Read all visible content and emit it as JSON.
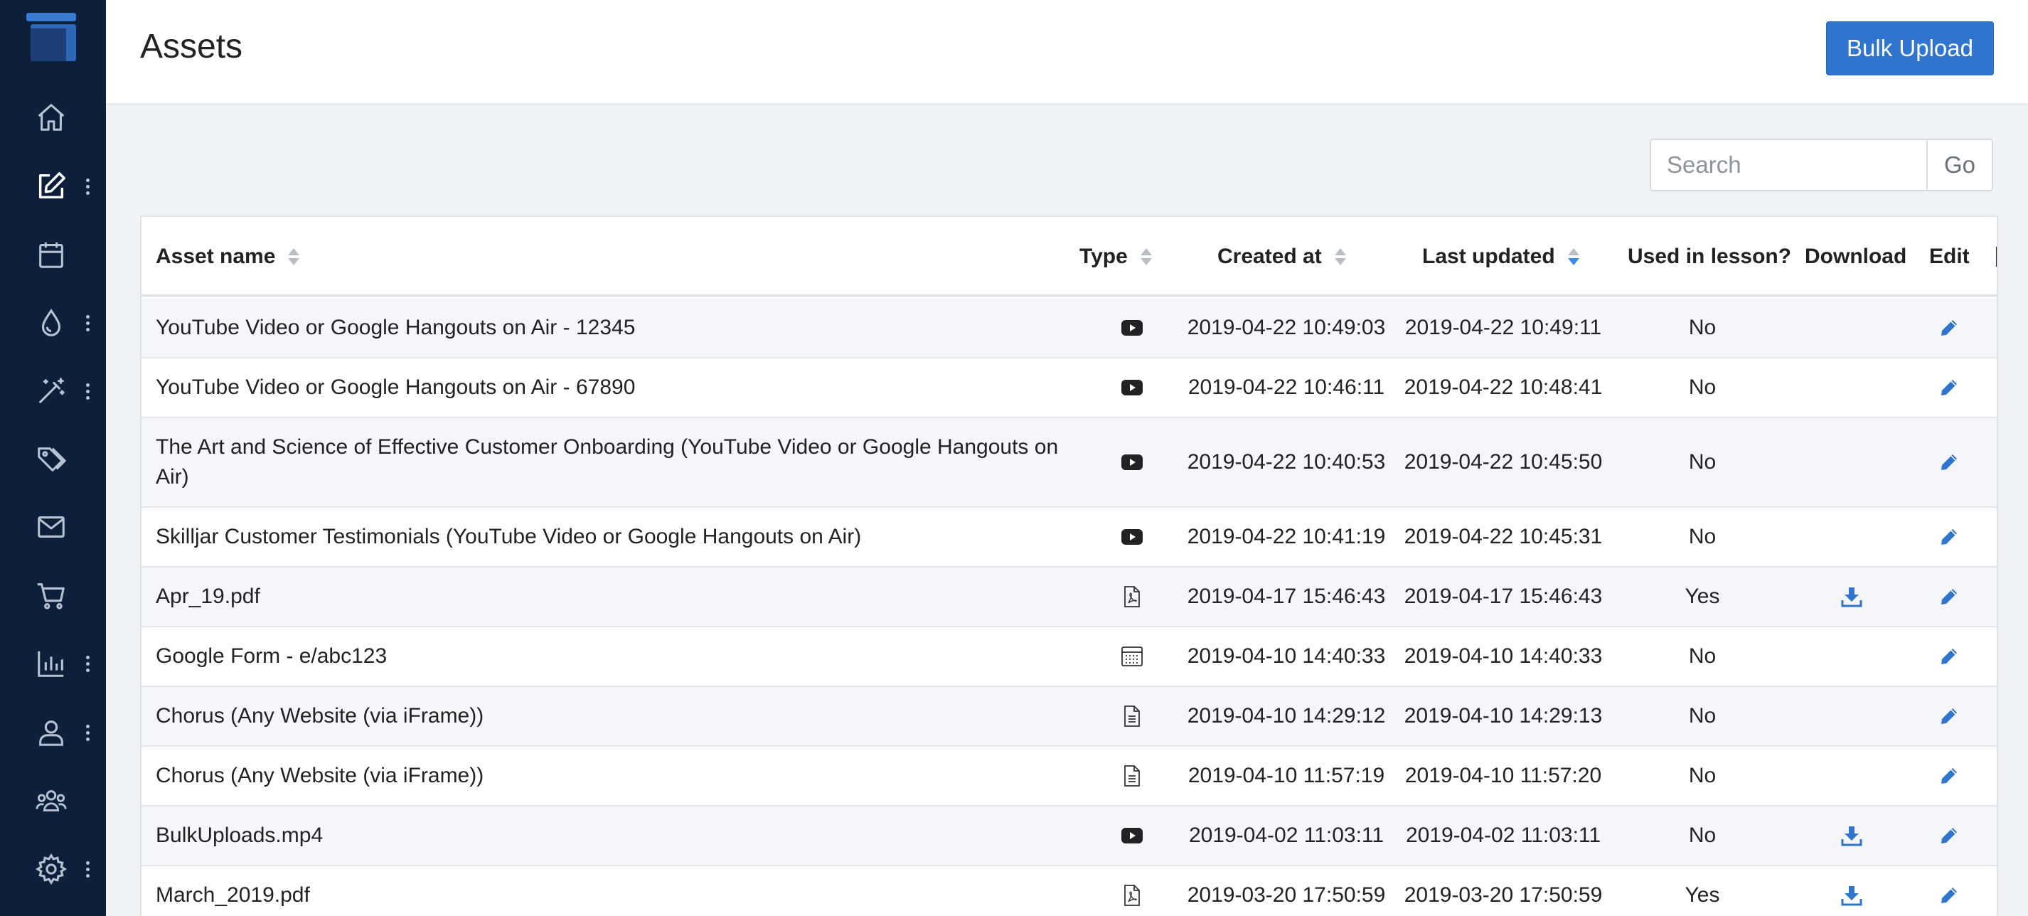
{
  "header": {
    "title": "Assets",
    "bulk_upload_label": "Bulk Upload"
  },
  "search": {
    "placeholder": "Search",
    "go_label": "Go"
  },
  "sidebar": {
    "items": [
      {
        "name": "home",
        "icon": "home-icon",
        "has_menu": false
      },
      {
        "name": "content",
        "icon": "edit-icon",
        "has_menu": true
      },
      {
        "name": "calendar",
        "icon": "calendar-icon",
        "has_menu": false
      },
      {
        "name": "theme",
        "icon": "drop-icon",
        "has_menu": true
      },
      {
        "name": "magic",
        "icon": "magic-wand-icon",
        "has_menu": true
      },
      {
        "name": "tags",
        "icon": "tags-icon",
        "has_menu": false
      },
      {
        "name": "mail",
        "icon": "mail-icon",
        "has_menu": false
      },
      {
        "name": "cart",
        "icon": "cart-icon",
        "has_menu": false
      },
      {
        "name": "analytics",
        "icon": "bar-chart-icon",
        "has_menu": true
      },
      {
        "name": "user",
        "icon": "user-icon",
        "has_menu": true
      },
      {
        "name": "groups",
        "icon": "users-icon",
        "has_menu": false
      },
      {
        "name": "settings",
        "icon": "gear-icon",
        "has_menu": true
      }
    ]
  },
  "table": {
    "columns": {
      "name": "Asset name",
      "type": "Type",
      "created": "Created at",
      "updated": "Last updated",
      "used": "Used in lesson?",
      "download": "Download",
      "edit": "Edit"
    },
    "rows": [
      {
        "name": "YouTube Video or Google Hangouts on Air - 12345",
        "type": "youtube",
        "created": "2019-04-22 10:49:03",
        "updated": "2019-04-22 10:49:11",
        "used": "No",
        "download": false
      },
      {
        "name": "YouTube Video or Google Hangouts on Air - 67890",
        "type": "youtube",
        "created": "2019-04-22 10:46:11",
        "updated": "2019-04-22 10:48:41",
        "used": "No",
        "download": false
      },
      {
        "name": "The Art and Science of Effective Customer Onboarding (YouTube Video or Google Hangouts on Air)",
        "type": "youtube",
        "created": "2019-04-22 10:40:53",
        "updated": "2019-04-22 10:45:50",
        "used": "No",
        "download": false
      },
      {
        "name": "Skilljar Customer Testimonials (YouTube Video or Google Hangouts on Air)",
        "type": "youtube",
        "created": "2019-04-22 10:41:19",
        "updated": "2019-04-22 10:45:31",
        "used": "No",
        "download": false
      },
      {
        "name": "Apr_19.pdf",
        "type": "pdf",
        "created": "2019-04-17 15:46:43",
        "updated": "2019-04-17 15:46:43",
        "used": "Yes",
        "download": true
      },
      {
        "name": "Google Form - e/abc123",
        "type": "form",
        "created": "2019-04-10 14:40:33",
        "updated": "2019-04-10 14:40:33",
        "used": "No",
        "download": false
      },
      {
        "name": "Chorus (Any Website (via iFrame))",
        "type": "web",
        "created": "2019-04-10 14:29:12",
        "updated": "2019-04-10 14:29:13",
        "used": "No",
        "download": false
      },
      {
        "name": "Chorus (Any Website (via iFrame))",
        "type": "web",
        "created": "2019-04-10 11:57:19",
        "updated": "2019-04-10 11:57:20",
        "used": "No",
        "download": false
      },
      {
        "name": "BulkUploads.mp4",
        "type": "youtube",
        "created": "2019-04-02 11:03:11",
        "updated": "2019-04-02 11:03:11",
        "used": "No",
        "download": true
      },
      {
        "name": "March_2019.pdf",
        "type": "pdf",
        "created": "2019-03-20 17:50:59",
        "updated": "2019-03-20 17:50:59",
        "used": "Yes",
        "download": true
      }
    ]
  },
  "colors": {
    "sidebar_bg": "#0e1f3b",
    "accent": "#2f74cf",
    "icon_blue": "#2f74cf"
  }
}
